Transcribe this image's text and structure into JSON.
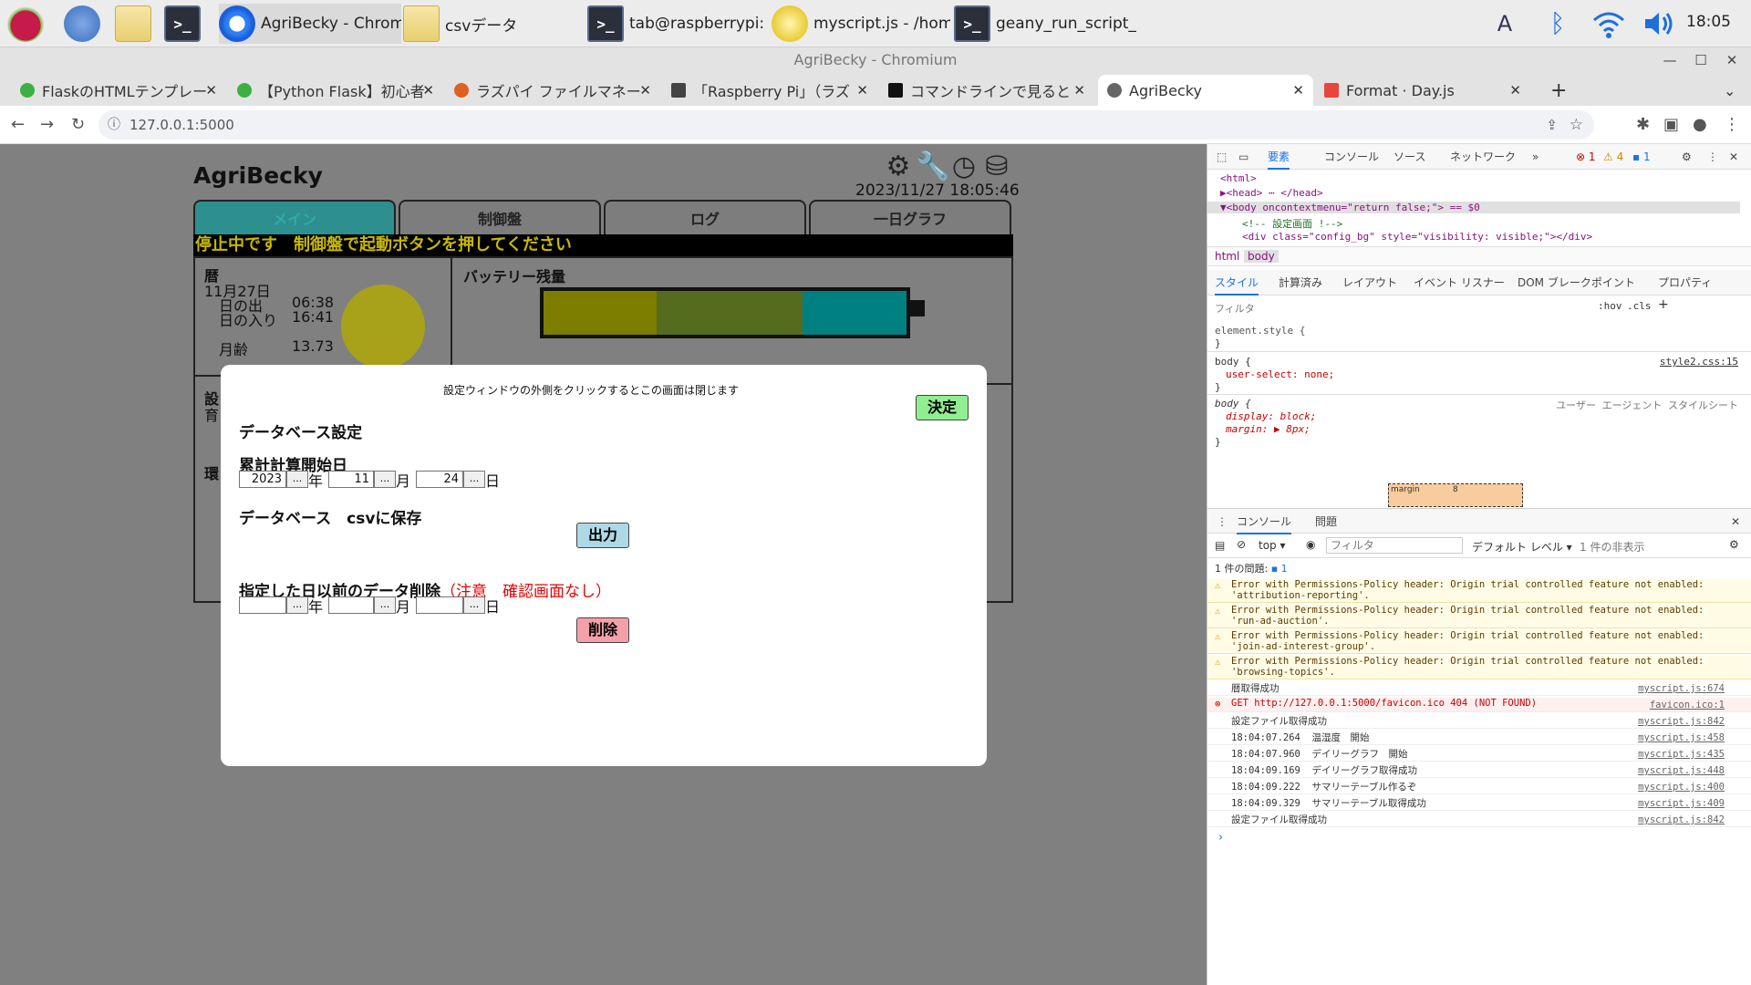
{
  "taskbar": {
    "apps": [
      {
        "label": "AgriBecky - Chromi...",
        "icon": "chromium-icon"
      },
      {
        "label": "csvデータ",
        "icon": "folder-icon"
      },
      {
        "label": "tab@raspberrypi: ...",
        "icon": "terminal-icon"
      },
      {
        "label": "myscript.js - /hom...",
        "icon": "geany-icon"
      },
      {
        "label": "geany_run_script_0...",
        "icon": "terminal-icon"
      }
    ],
    "clock": "18:05"
  },
  "browser": {
    "window_title": "AgriBecky - Chromium",
    "tabs": [
      {
        "label": "FlaskのHTMLテンプレー",
        "color": "#3cb043"
      },
      {
        "label": "【Python Flask】初心者",
        "color": "#3cb043"
      },
      {
        "label": "ラズパイ ファイルマネー",
        "color": "#e06020"
      },
      {
        "label": "「Raspberry Pi」（ラズ",
        "color": "#444444"
      },
      {
        "label": "コマンドラインで見ると",
        "color": "#111111"
      },
      {
        "label": "AgriBecky",
        "color": "#666666"
      },
      {
        "label": "Format · Day.js",
        "color": "#e8453c"
      }
    ],
    "url": "127.0.0.1:5000",
    "new_tab_label": "+"
  },
  "app": {
    "title": "AgriBecky",
    "datetime": "2023/11/27 18:05:46",
    "tabs": [
      "メイン",
      "制御盤",
      "ログ",
      "一日グラフ"
    ],
    "status_message": "停止中です　制御盤で起動ボタンを押してください",
    "calendar_label": "暦",
    "date": "11月27日",
    "sunrise_label": "日の出",
    "sunrise": "06:38",
    "sunset_label": "日の入り",
    "sunset": "16:41",
    "moon_age_label": "月齢",
    "moon_age": "13.73",
    "battery_label": "バッテリー残量",
    "partial_label_1": "設",
    "partial_label_2": "育",
    "partial_label_3": "環"
  },
  "modal": {
    "hint": "設定ウィンドウの外側をクリックするとこの画面は閉じます",
    "confirm_label": "決定",
    "db_heading": "データベース設定",
    "accum_label": "累計計算開始日",
    "accum_year": "2023",
    "accum_month": "11",
    "accum_day": "24",
    "year_unit": "年",
    "month_unit": "月",
    "day_unit": "日",
    "dots": "...",
    "csv_label": "データベース　csvに保存",
    "output_label": "出力",
    "delete_heading": "指定した日以前のデータ削除",
    "delete_warning": "（注意　確認画面なし）",
    "delete_year": "",
    "delete_month": "",
    "delete_day": "",
    "delete_label": "削除"
  },
  "devtools": {
    "tabs": [
      "要素",
      "コンソール",
      "ソース",
      "ネットワーク"
    ],
    "errors": "1",
    "warnings": "4",
    "info": "1",
    "dom": [
      "<html>",
      "▶<head> ⋯ </head>",
      "▼<body oncontextmenu=\"return false;\"> == $0",
      "<!-- 設定画面 !-->",
      "<div class=\"config_bg\" style=\"visibility: visible;\"></div>"
    ],
    "breadcrumbs": [
      "html",
      "body"
    ],
    "style_tabs": [
      "スタイル",
      "計算済み",
      "レイアウト",
      "イベント リスナー",
      "DOM ブレークポイント",
      "プロパティ"
    ],
    "filter_placeholder": "フィルタ",
    "hov": ":hov",
    "cls": ".cls",
    "styles": {
      "element_style": "element.style {",
      "rule1_selector": "body {",
      "rule1_prop": "user-select: none;",
      "rule1_source": "style2.css:15",
      "rule2_selector": "body {",
      "rule2_source": "ユーザー エージェント スタイルシート",
      "rule2_prop1": "display: block;",
      "rule2_prop2": "margin: ▶ 8px;",
      "close_brace": "}",
      "box_margin_label": "margin",
      "box_margin_value": "8"
    },
    "console_tabs": [
      "コンソール",
      "問題"
    ],
    "console_context": "top",
    "console_level": "デフォルト レベル",
    "console_hidden": "1 件の非表示",
    "issues": "1 件の問題:",
    "issues_count": "1",
    "console": [
      {
        "type": "warn",
        "text": "Error with Permissions-Policy header: Origin trial controlled feature not enabled:\n'attribution-reporting'.",
        "src": ""
      },
      {
        "type": "warn",
        "text": "Error with Permissions-Policy header: Origin trial controlled feature not enabled:\n'run-ad-auction'.",
        "src": ""
      },
      {
        "type": "warn",
        "text": "Error with Permissions-Policy header: Origin trial controlled feature not enabled:\n'join-ad-interest-group'.",
        "src": ""
      },
      {
        "type": "warn",
        "text": "Error with Permissions-Policy header: Origin trial controlled feature not enabled:\n'browsing-topics'.",
        "src": ""
      },
      {
        "type": "log",
        "text": "暦取得成功",
        "src": "myscript.js:674"
      },
      {
        "type": "err",
        "text": "GET http://127.0.0.1:5000/favicon.ico 404 (NOT FOUND)",
        "src": "favicon.ico:1"
      },
      {
        "type": "log",
        "text": "設定ファイル取得成功",
        "src": "myscript.js:842"
      },
      {
        "type": "log",
        "text": "18:04:07.264  温湿度　開始",
        "src": "myscript.js:458"
      },
      {
        "type": "log",
        "text": "18:04:07.960  デイリーグラフ　開始",
        "src": "myscript.js:435"
      },
      {
        "type": "log",
        "text": "18:04:09.169  デイリーグラフ取得成功",
        "src": "myscript.js:448"
      },
      {
        "type": "log",
        "text": "18:04:09.222  サマリーテーブル作るぞ",
        "src": "myscript.js:400"
      },
      {
        "type": "log",
        "text": "18:04:09.329  サマリーテーブル取得成功",
        "src": "myscript.js:409"
      },
      {
        "type": "log",
        "text": "設定ファイル取得成功",
        "src": "myscript.js:842"
      }
    ],
    "prompt": "›"
  },
  "colors": {
    "battery": [
      "#7d7d00",
      "#556b1e",
      "#008080"
    ],
    "modal_confirm": "#90ee90",
    "modal_output": "#add8e6",
    "modal_delete": "#f4a0a8",
    "warning_red": "#e60000",
    "status_text": "#c8b800"
  }
}
